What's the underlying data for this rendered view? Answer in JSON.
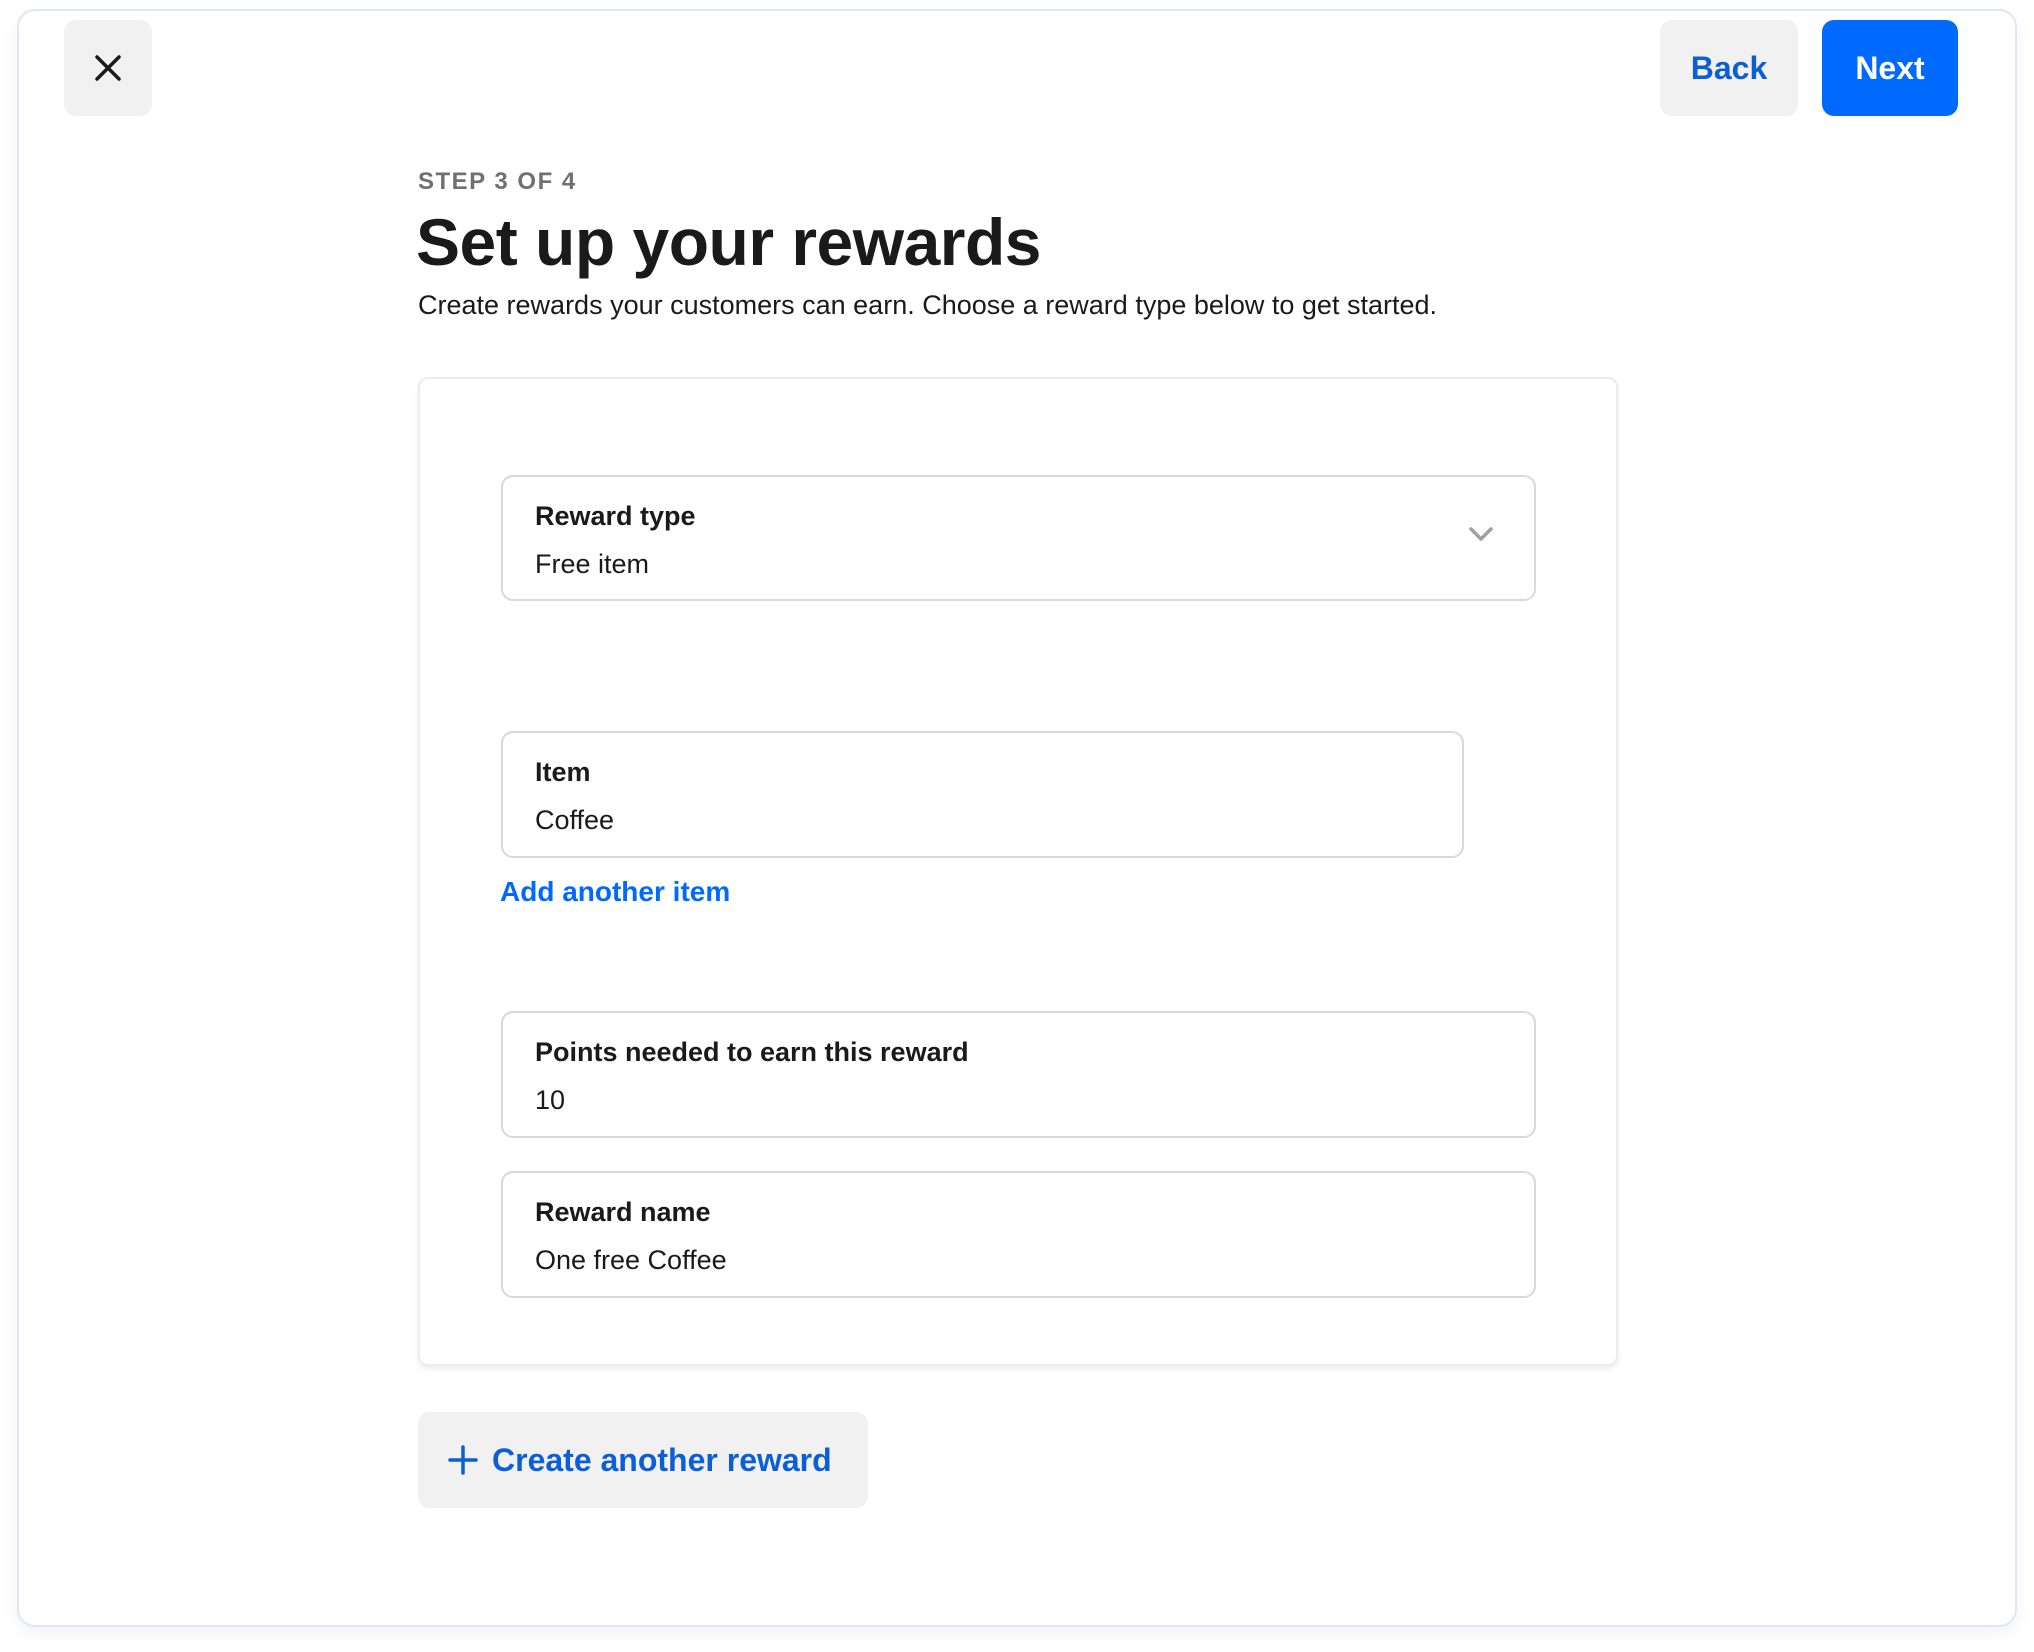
{
  "header": {
    "close_icon": "close-icon",
    "back_label": "Back",
    "next_label": "Next"
  },
  "page": {
    "step": "STEP 3 OF 4",
    "title": "Set up your rewards",
    "subtitle": "Create rewards your customers can earn. Choose a reward type below to get started."
  },
  "reward_card": {
    "reward_type": {
      "label": "Reward type",
      "value": "Free item",
      "icon": "chevron-down-icon"
    },
    "item": {
      "label": "Item",
      "value": "Coffee"
    },
    "add_item_link": "Add another item",
    "points": {
      "label": "Points needed to earn this reward",
      "value": "10"
    },
    "reward_name": {
      "label": "Reward name",
      "value": "One free Coffee"
    }
  },
  "create_another": {
    "icon": "plus-icon",
    "label": "Create another reward"
  },
  "colors": {
    "primary": "#006aff",
    "link_text": "#0b5fd6",
    "secondary_button_bg": "#f1f1f1",
    "field_border": "#d9d9d9"
  }
}
